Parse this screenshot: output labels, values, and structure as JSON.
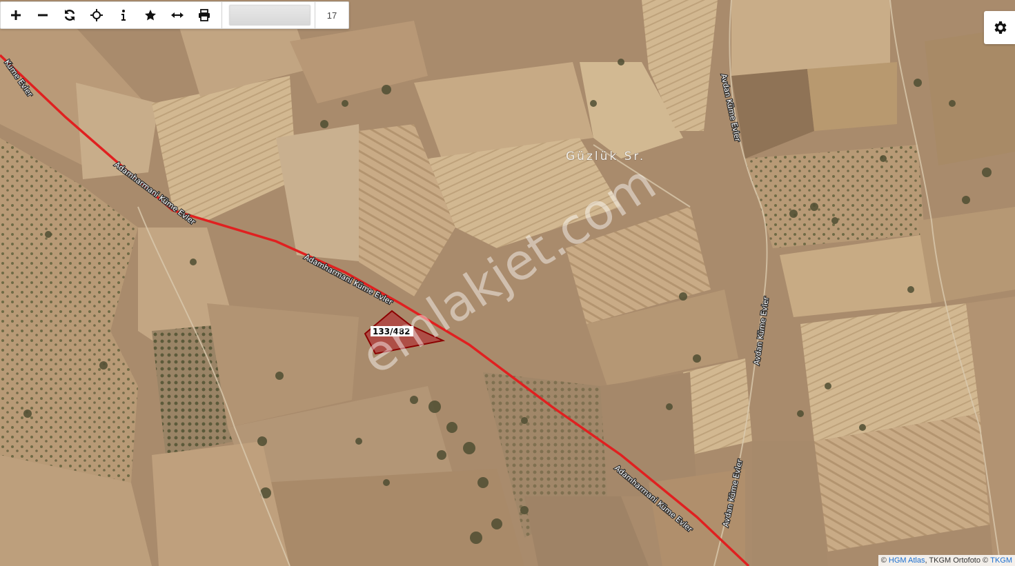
{
  "toolbar": {
    "buttons": [
      {
        "name": "zoom-in-button",
        "icon": "plus-icon"
      },
      {
        "name": "zoom-out-button",
        "icon": "minus-icon"
      },
      {
        "name": "refresh-button",
        "icon": "refresh-icon"
      },
      {
        "name": "locate-button",
        "icon": "crosshair-icon"
      },
      {
        "name": "info-button",
        "icon": "info-icon"
      },
      {
        "name": "favorite-button",
        "icon": "star-icon"
      },
      {
        "name": "measure-button",
        "icon": "measure-icon"
      },
      {
        "name": "print-button",
        "icon": "printer-icon"
      }
    ],
    "search_value": "",
    "zoom_level": "17"
  },
  "settings": {
    "icon": "gear-icon"
  },
  "map": {
    "place_label": "Güzlük Sr.",
    "road_labels": [
      "Kume Evler",
      "Adamharmani Küme Evler",
      "Adamharmani Küme Evler",
      "Adamharmani Küme Evler",
      "Avdan Küme Evler",
      "Avdan Küme Evler",
      "Avdan Küme Evler"
    ],
    "parcel": {
      "label": "133/482",
      "fill": "#b03a3a",
      "stroke": "#8b0000"
    },
    "watermark": "emlakjet.com",
    "road_color": "#e02020"
  },
  "attribution": {
    "prefix": "©",
    "hgm": "HGM Atlas",
    "middle": ", TKGM Ortofoto ©",
    "tkgm": "TKGM"
  }
}
